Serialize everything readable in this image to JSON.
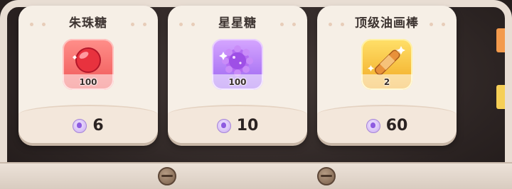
{
  "shop": {
    "items": [
      {
        "title": "朱珠糖",
        "count": "100",
        "price": "6",
        "icon": "red-candy-icon",
        "tile_color": "#ef5656"
      },
      {
        "title": "星星糖",
        "count": "100",
        "price": "10",
        "icon": "star-candy-icon",
        "tile_color": "#9a63f0"
      },
      {
        "title": "顶级油画棒",
        "count": "2",
        "price": "60",
        "icon": "oil-pastel-icon",
        "tile_color": "#f1a822"
      }
    ],
    "currency_icon": "purple-crystal-currency-icon"
  }
}
